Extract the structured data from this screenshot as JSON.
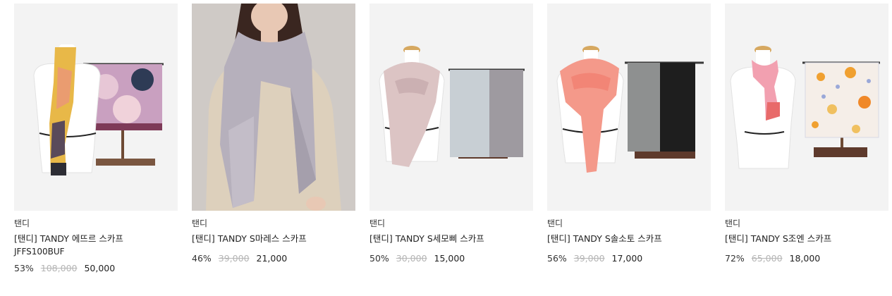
{
  "products": [
    {
      "brand": "탠디",
      "name": "[탠디] TANDY 에뜨르 스카프",
      "code": "JFFS100BUF",
      "discount": "53%",
      "original_price": "108,000",
      "sale_price": "50,000",
      "colors": {
        "scarf_main": "#e8b848",
        "scarf_accent": "#ea9c70",
        "display": "#8a5a9a"
      }
    },
    {
      "brand": "탠디",
      "name": "[탠디] TANDY S마레스 스카프",
      "discount": "46%",
      "original_price": "39,000",
      "sale_price": "21,000",
      "colors": {
        "scarf_main": "#b6b0bc",
        "background": "#cfcac6"
      }
    },
    {
      "brand": "탠디",
      "name": "[탠디] TANDY S세모삐 스카프",
      "discount": "50%",
      "original_price": "30,000",
      "sale_price": "15,000",
      "colors": {
        "scarf_main": "#dcc4c4",
        "display_1": "#c8cfd4",
        "display_2": "#9e9aa0"
      }
    },
    {
      "brand": "탠디",
      "name": "[탠디] TANDY S솔소토 스카프",
      "discount": "56%",
      "original_price": "39,000",
      "sale_price": "17,000",
      "colors": {
        "scarf_main": "#f4998a",
        "display_1": "#8e9090",
        "display_2": "#1e1e1e"
      }
    },
    {
      "brand": "탠디",
      "name": "[탠디] TANDY S조엔 스카프",
      "discount": "72%",
      "original_price": "65,000",
      "sale_price": "18,000",
      "colors": {
        "scarf_main": "#f2a0b0",
        "display": "#f5eee8",
        "flowers": "#f0a030"
      }
    }
  ]
}
